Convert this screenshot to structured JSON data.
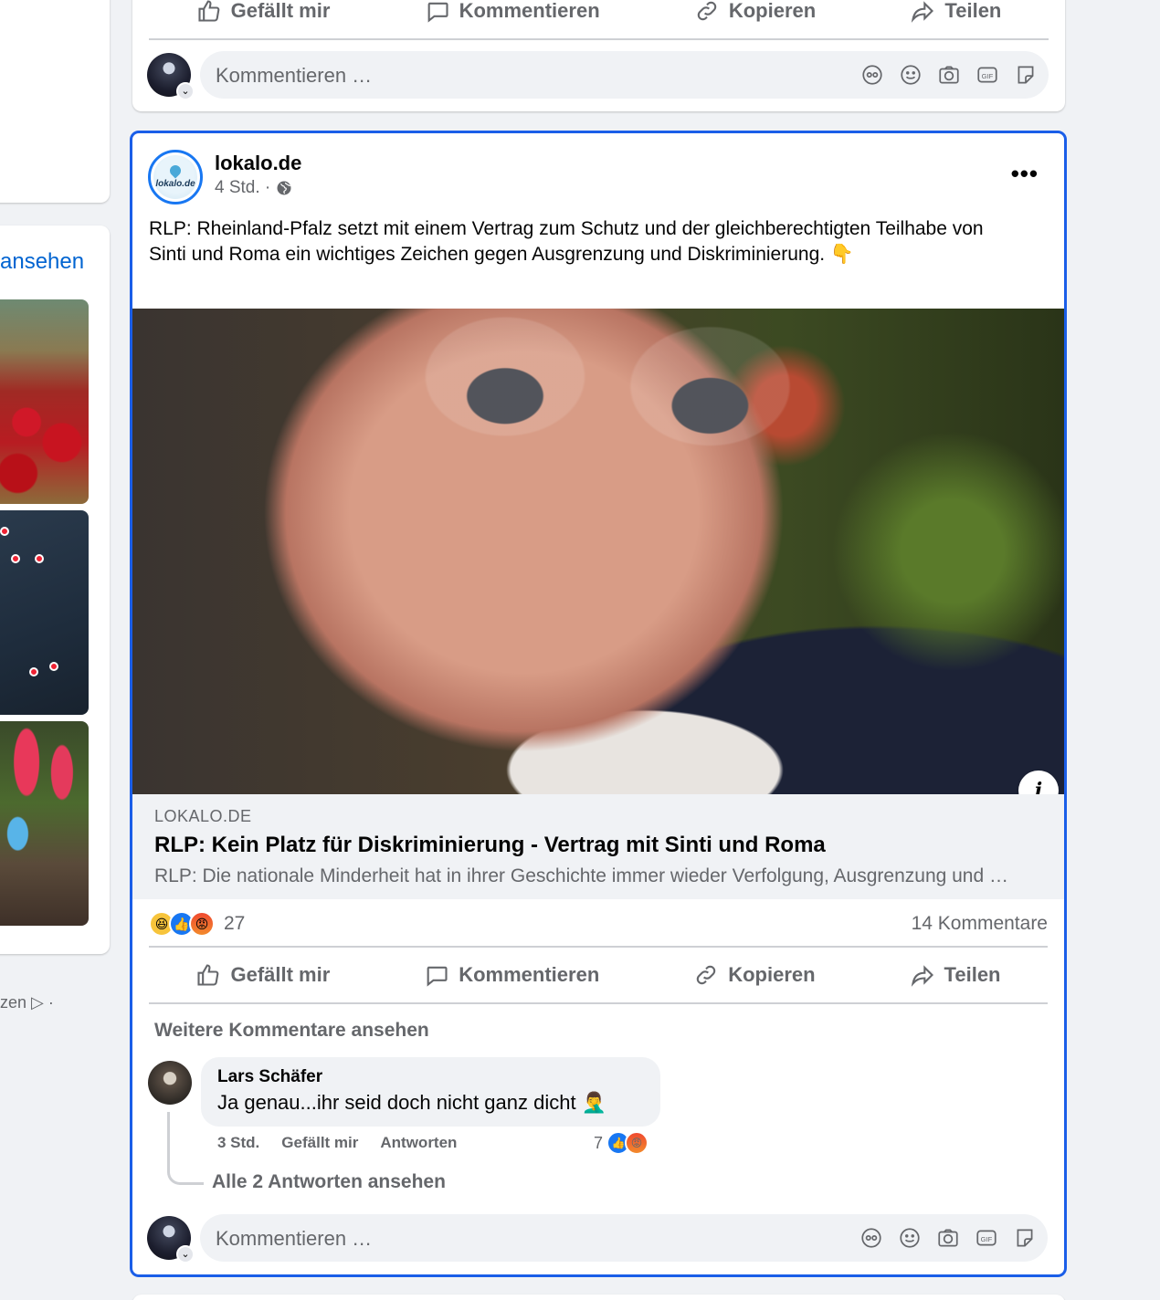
{
  "sidebar": {
    "link_label": "ansehen",
    "footer_text": "zen ▷ ·"
  },
  "prev_post": {
    "actions": {
      "like": "Gefällt mir",
      "comment": "Kommentieren",
      "copy": "Kopieren",
      "share": "Teilen"
    },
    "composer_placeholder": "Kommentieren …"
  },
  "post": {
    "page_name": "lokalo.de",
    "logo_text": "lokalo.de",
    "time": "4 Std. ·",
    "privacy_icon": "globe-icon",
    "body_text": "RLP: Rheinland-Pfalz setzt mit einem Vertrag zum Schutz und der gleichberechtigten Teilhabe von Sinti und Roma ein wichtiges Zeichen gegen Ausgrenzung und Diskriminierung.  👇",
    "info_button": "i",
    "link_preview": {
      "domain": "LOKALO.DE",
      "title": "RLP: Kein Platz für Diskriminierung - Vertrag mit Sinti und Roma",
      "description": "RLP: Die nationale Minderheit hat in ihrer Geschichte immer wieder Verfolgung, Ausgrenzung und Diskriminierung erfahren…"
    },
    "reactions": {
      "types": [
        "haha",
        "like",
        "angry"
      ],
      "count": "27",
      "comments": "14 Kommentare"
    },
    "actions": {
      "like": "Gefällt mir",
      "comment": "Kommentieren",
      "copy": "Kopieren",
      "share": "Teilen"
    },
    "more_comments": "Weitere Kommentare ansehen",
    "comment": {
      "author": "Lars Schäfer",
      "text": "Ja genau...ihr seid doch nicht ganz dicht 🤦‍♂️",
      "time": "3 Std.",
      "like": "Gefällt mir",
      "reply": "Antworten",
      "reaction_count": "7"
    },
    "all_replies": "Alle 2 Antworten ansehen",
    "composer_placeholder": "Kommentieren …"
  },
  "colors": {
    "accent": "#1a5ee8",
    "link": "#0064d1",
    "secondary_text": "#65676b"
  }
}
